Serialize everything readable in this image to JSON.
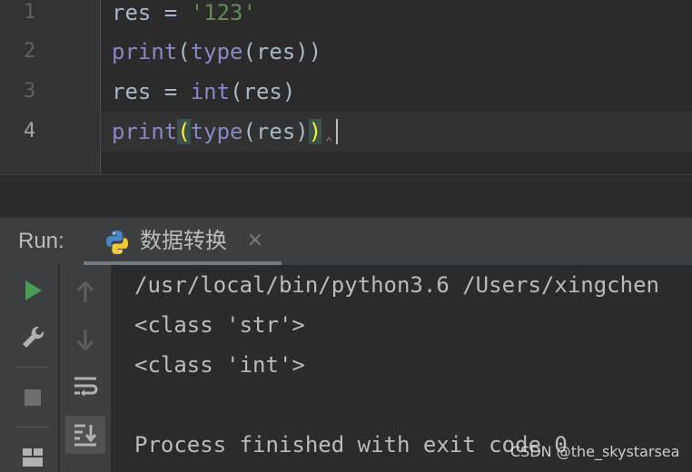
{
  "editor": {
    "line_numbers": [
      "1",
      "2",
      "3",
      "4"
    ],
    "lines": [
      {
        "t1": "res = ",
        "t2": "'123'"
      },
      {
        "t1": "print",
        "t2": "(",
        "t3": "type",
        "t4": "(res))"
      },
      {
        "t1": "res = ",
        "t2": "int",
        "t3": "(res)"
      },
      {
        "t1": "print",
        "t2": "(",
        "t3": "type",
        "t4": "(res)",
        "t5": ")"
      }
    ]
  },
  "run_panel": {
    "label": "Run:",
    "tab_label": "数据转换",
    "tab_close": "×",
    "console_lines": [
      "/usr/local/bin/python3.6 /Users/xingchen",
      "<class 'str'>",
      "<class 'int'>",
      "",
      "Process finished with exit code 0"
    ]
  },
  "icons": {
    "python": "python-icon",
    "rerun": "play-icon",
    "settings": "wrench-icon",
    "stop": "stop-icon",
    "layout": "layout-icon",
    "up": "arrow-up-icon",
    "down": "arrow-down-icon",
    "wrap": "soft-wrap-icon",
    "scroll_end": "scroll-to-end-icon"
  },
  "watermark": "CSDN @the_skystarsea",
  "colors": {
    "background": "#2b2b2b",
    "string": "#6a8759",
    "builtin": "#8888c6",
    "run_green": "#499c54",
    "bracket_highlight": "#ffef28"
  }
}
